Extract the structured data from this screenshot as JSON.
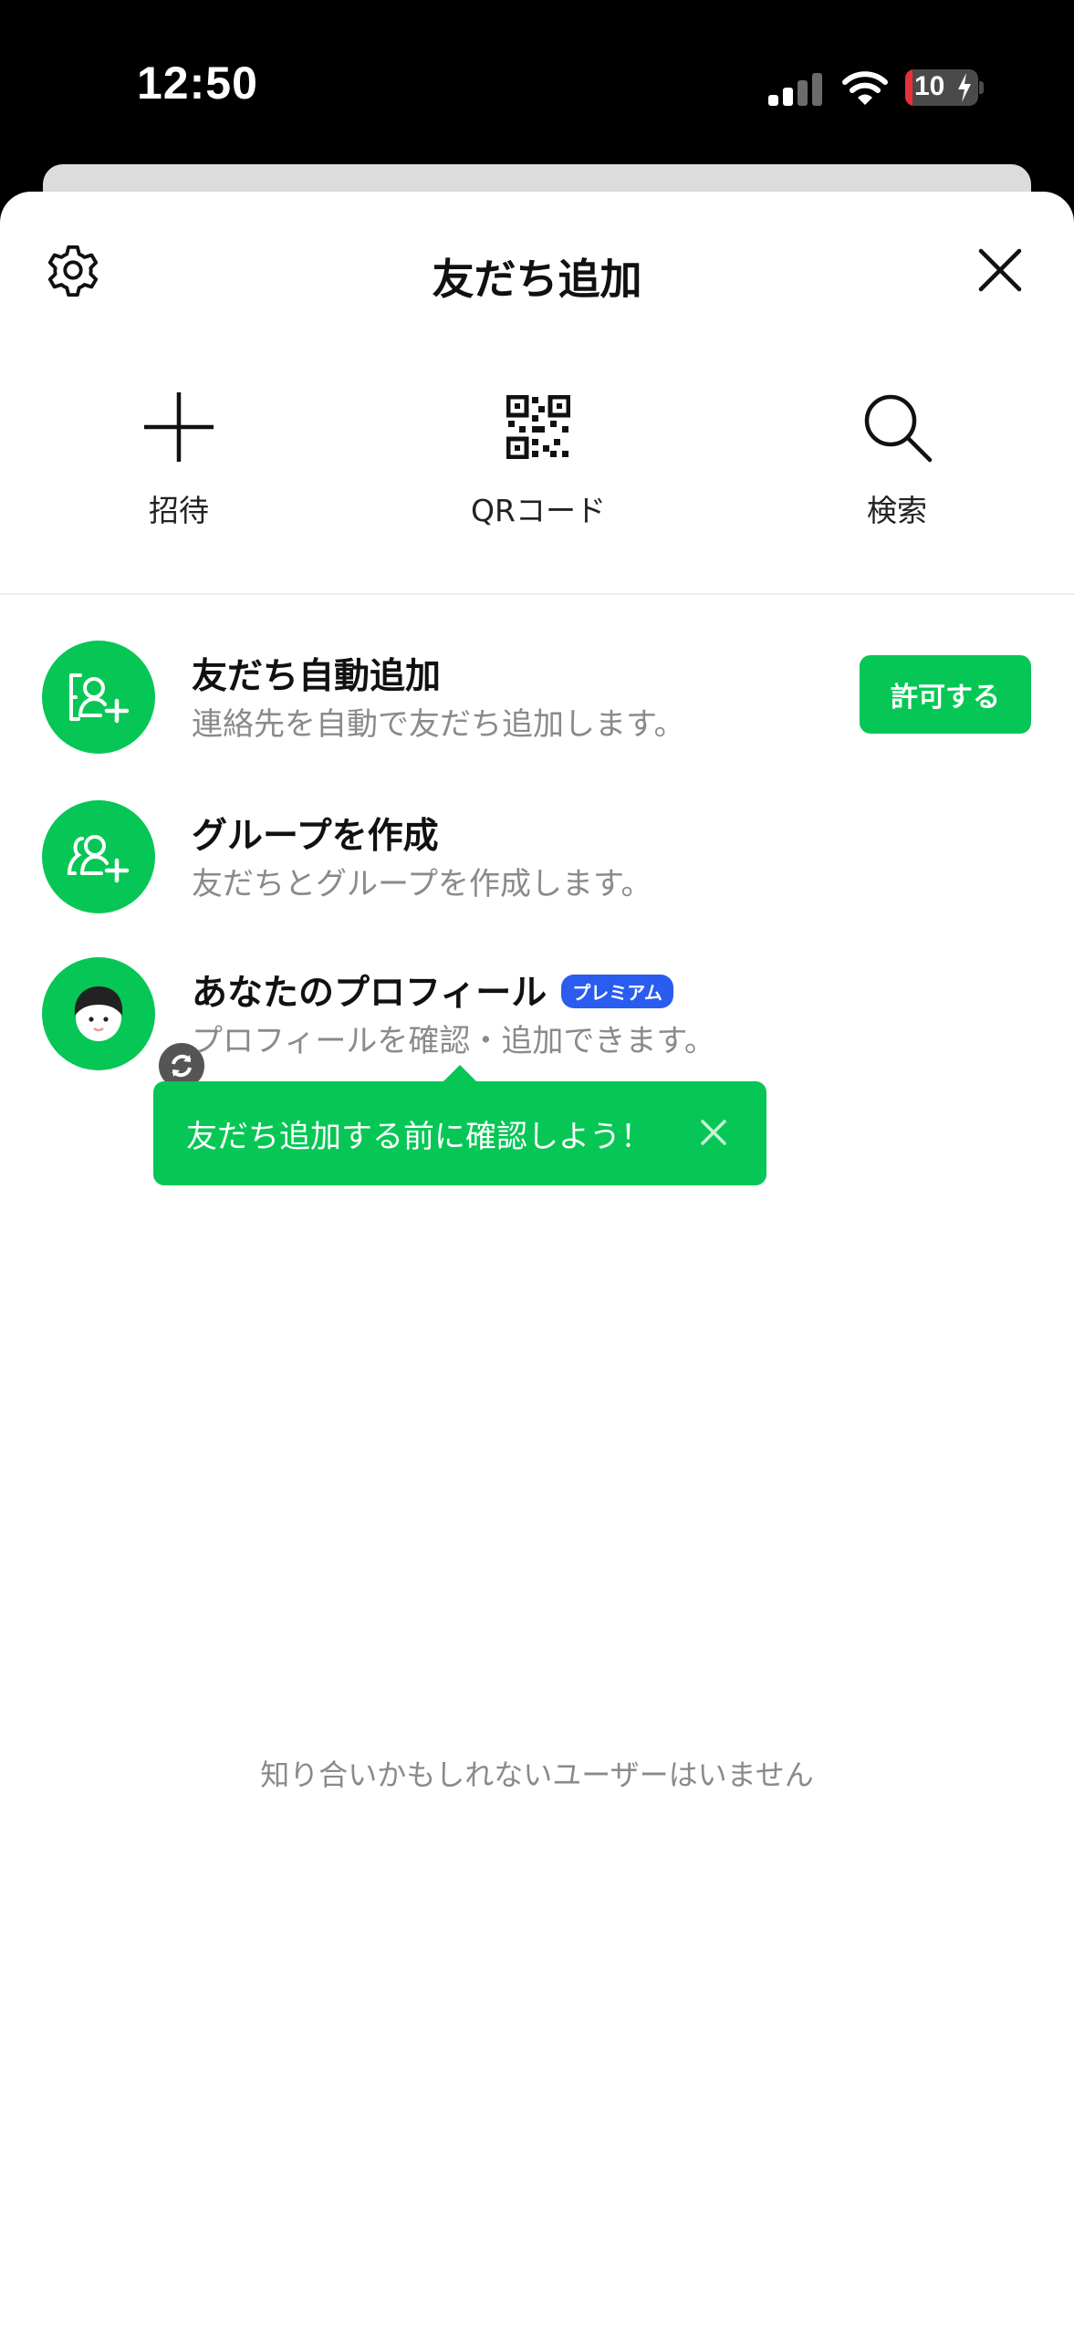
{
  "status_bar": {
    "time": "12:50",
    "battery": "10",
    "battery_level": 0.1
  },
  "header": {
    "title": "友だち追加",
    "settings_icon": "gear-icon",
    "close_icon": "close-icon"
  },
  "quick_actions": [
    {
      "label": "招待",
      "icon": "plus-icon"
    },
    {
      "label": "QRコード",
      "icon": "qr-code-icon"
    },
    {
      "label": "検索",
      "icon": "search-icon"
    }
  ],
  "rows": [
    {
      "title": "友だち自動追加",
      "subtitle": "連絡先を自動で友だち追加します。",
      "icon": "contact-add-icon",
      "action": "許可する"
    },
    {
      "title": "グループを作成",
      "subtitle": "友だちとグループを作成します。",
      "icon": "group-add-icon"
    },
    {
      "title": "あなたのプロフィール",
      "badge": "プレミアム",
      "subtitle": "プロフィールを確認・追加できます。",
      "icon": "profile-avatar-icon"
    }
  ],
  "tooltip": {
    "text": "友だち追加する前に確認しよう！"
  },
  "empty_message": "知り合いかもしれないユーザーはいません",
  "colors": {
    "accent": "#06c755",
    "premium": "#2a5cf0",
    "battery_low": "#e8303a"
  }
}
